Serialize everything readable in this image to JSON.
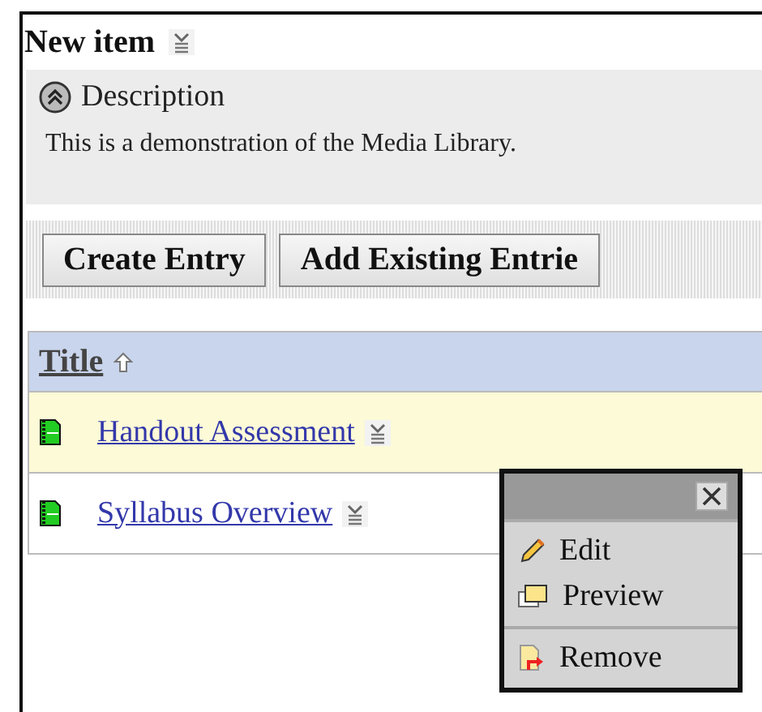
{
  "header": {
    "title": "New item"
  },
  "description": {
    "heading": "Description",
    "expanded": true,
    "text": "This is a demonstration of the Media Library."
  },
  "toolbar": {
    "buttons": [
      "Create Entry",
      "Add Existing Entrie"
    ]
  },
  "table": {
    "columns": [
      {
        "label": "Title",
        "sorted_ascending": true
      }
    ],
    "rows": [
      {
        "title": "Handout Assessment",
        "highlighted": true
      },
      {
        "title": "Syllabus Overview",
        "highlighted": false
      }
    ]
  },
  "context_menu": {
    "groups": [
      [
        {
          "kind": "edit",
          "label": "Edit"
        },
        {
          "kind": "preview",
          "label": "Preview"
        }
      ],
      [
        {
          "kind": "remove",
          "label": "Remove"
        }
      ]
    ]
  }
}
